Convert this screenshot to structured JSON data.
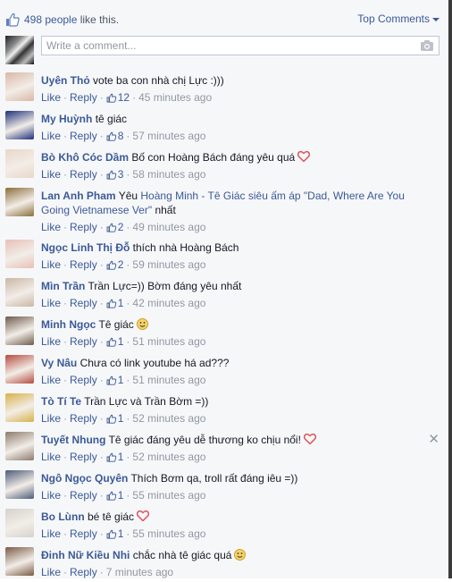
{
  "header": {
    "likes_count": "498 people",
    "likes_suffix": " like this.",
    "sort_label": "Top Comments"
  },
  "compose": {
    "placeholder": "Write a comment..."
  },
  "meta_labels": {
    "like": "Like",
    "reply": "Reply"
  },
  "comments": [
    {
      "name": "Uyên Thỏ",
      "text": "vote ba con nhà chị Lực :)))",
      "likes": "12",
      "time": "45 minutes ago",
      "avatar_color": "#d9b8a8"
    },
    {
      "name": "My Huỳnh",
      "text": "tê giác",
      "likes": "8",
      "time": "57 minutes ago",
      "avatar_color": "#1f2f7a"
    },
    {
      "name": "Bò Khô Cóc Dầm",
      "text": "Bố con Hoàng Bách đáng yêu quá",
      "likes": "3",
      "time": "58 minutes ago",
      "avatar_color": "#e8d7c8"
    },
    {
      "name": "Lan Anh Pham",
      "text_pre": "Yêu ",
      "text_link": "Hoàng Minh - Tê Giác siêu ấm áp \"Dad, Where Are You Going Vietnamese Ver\"",
      "text_post": " nhất",
      "likes": "2",
      "time": "49 minutes ago",
      "avatar_color": "#8a6e3a"
    },
    {
      "name": "Ngọc Linh Thị Đỗ",
      "text": "thích nhà Hoàng Bách",
      "likes": "2",
      "time": "59 minutes ago",
      "avatar_color": "#e7c0b8"
    },
    {
      "name": "Mìn Trần",
      "text": "Trần Lực=)) Bờm đáng yêu nhất",
      "likes": "1",
      "time": "42 minutes ago",
      "avatar_color": "#c9b7a5"
    },
    {
      "name": "Minh Ngọc",
      "text": "Tê giác",
      "likes": "1",
      "time": "51 minutes ago",
      "avatar_color": "#6e5a4b"
    },
    {
      "name": "Vy Nâu",
      "text": "Chưa có link youtube há ad???",
      "likes": "1",
      "time": "51 minutes ago",
      "avatar_color": "#b54b3e"
    },
    {
      "name": "Tò Tí Te",
      "text": "Trần Lực và Trần Bờm =))",
      "likes": "1",
      "time": "52 minutes ago",
      "avatar_color": "#d8b24a"
    },
    {
      "name": "Tuyết Nhung",
      "text": "Tê giác đáng yêu dễ thương ko chịu nổi!",
      "likes": "1",
      "time": "52 minutes ago",
      "avatar_color": "#8c7b6d"
    },
    {
      "name": "Ngô Ngọc Quyên",
      "text": "Thích Bơm qa, troll rất đáng iêu =))",
      "likes": "1",
      "time": "55 minutes ago",
      "avatar_color": "#4d5b7a"
    },
    {
      "name": "Bo Lùnn",
      "text": "bé tê giác",
      "likes": "1",
      "time": "55 minutes ago",
      "avatar_color": "#d5d2cc"
    },
    {
      "name": "Đinh Nữ Kiều Nhi",
      "text": "chắc nhà tê giác quá",
      "likes": "",
      "time": "7 minutes ago",
      "avatar_color": "#7a5a45"
    }
  ],
  "colors": {
    "link": "#3b5998",
    "muted": "#9197a3",
    "heart": "#e0545a"
  },
  "icons": {
    "heart": "heart-icon",
    "thumb": "thumbs-up-icon",
    "camera": "camera-icon",
    "smile": "smile-emoji-icon",
    "close": "close-icon"
  }
}
